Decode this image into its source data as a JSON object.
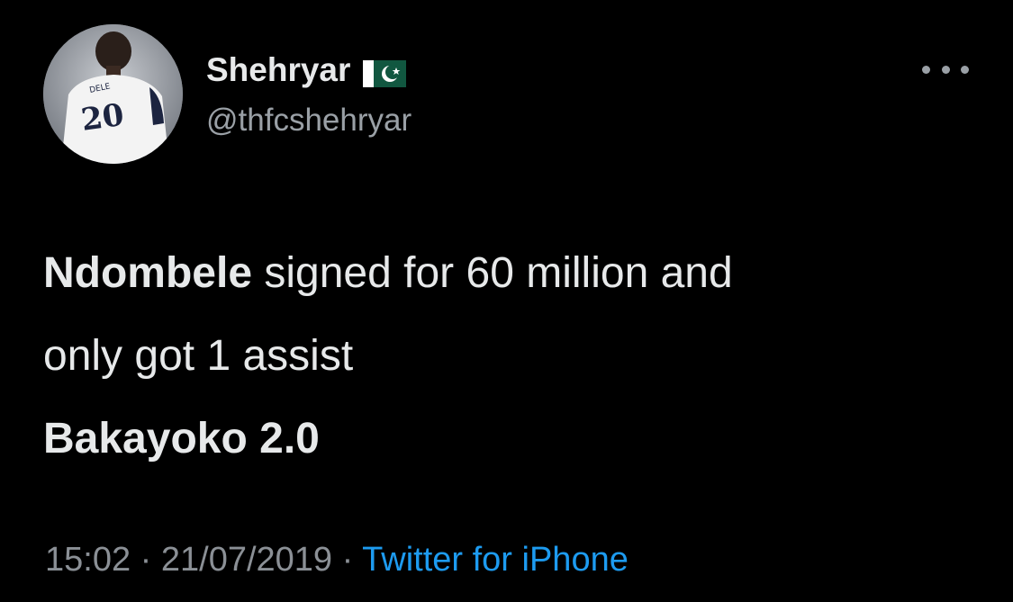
{
  "user": {
    "display_name": "Shehryar",
    "flag_icon": "pakistan-flag-icon",
    "handle": "@thfcshehryar",
    "avatar_text": {
      "name": "DELE",
      "number": "20"
    }
  },
  "more_icon": "more-horizontal-icon",
  "tweet": {
    "line1_bold": "Ndombele",
    "line1_rest": " signed for 60 million and",
    "line2": "only got 1 assist",
    "line3": "Bakayoko 2.0"
  },
  "meta": {
    "time": "15:02",
    "separator": " · ",
    "date": "21/07/2019",
    "source": "Twitter for iPhone"
  },
  "colors": {
    "background": "#000000",
    "text": "#e7e9ea",
    "secondary": "#8b9096",
    "link": "#1d9bf0"
  }
}
